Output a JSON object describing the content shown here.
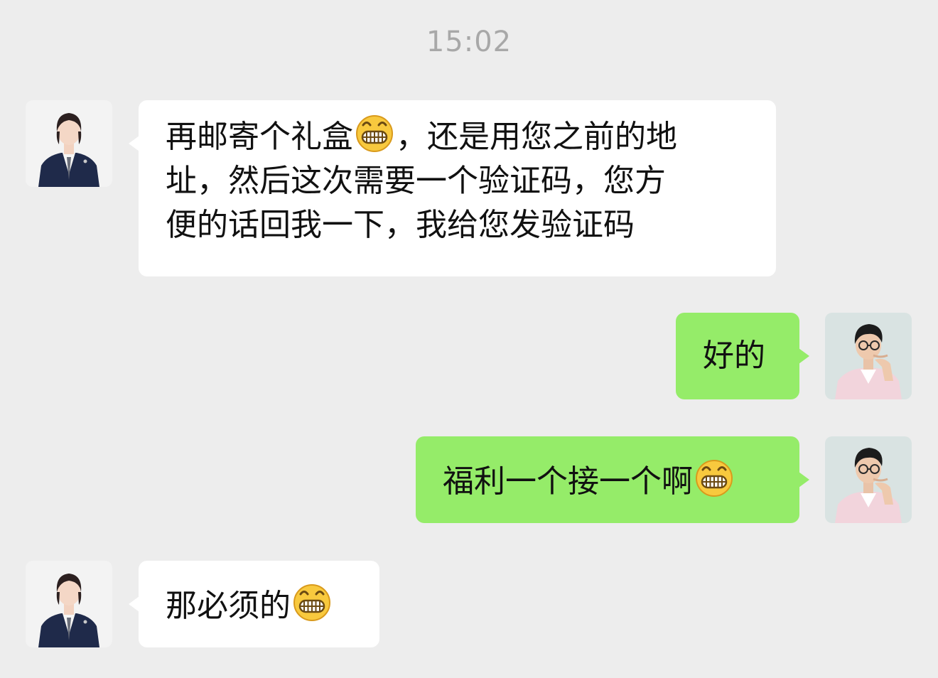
{
  "chat": {
    "timestamp": "15:02",
    "messages": [
      {
        "side": "incoming",
        "lines": [
          {
            "before": "再邮寄个礼盒",
            "emoji": "grinning-face-emoji",
            "after": "，还是用您之前的地"
          },
          {
            "before": "址，然后这次需要一个验证码，您方",
            "emoji": "",
            "after": ""
          },
          {
            "before": "便的话回我一下，我给您发验证码",
            "emoji": "",
            "after": ""
          }
        ]
      },
      {
        "side": "outgoing",
        "lines": [
          {
            "before": "好的",
            "emoji": "",
            "after": ""
          }
        ]
      },
      {
        "side": "outgoing",
        "lines": [
          {
            "before": "福利一个接一个啊",
            "emoji": "grinning-face-emoji",
            "after": ""
          }
        ]
      },
      {
        "side": "incoming",
        "lines": [
          {
            "before": "那必须的",
            "emoji": "grinning-face-emoji",
            "after": ""
          }
        ]
      }
    ]
  },
  "colors": {
    "background": "#ededed",
    "incoming_bubble": "#ffffff",
    "outgoing_bubble": "#95ec69",
    "timestamp_text": "#a8a8a8",
    "message_text": "#111111"
  },
  "icons": {
    "contact_avatar": "contact-avatar-woman-in-suit",
    "user_avatar": "user-avatar-man-with-glasses",
    "emoji": "grinning-face-emoji"
  }
}
